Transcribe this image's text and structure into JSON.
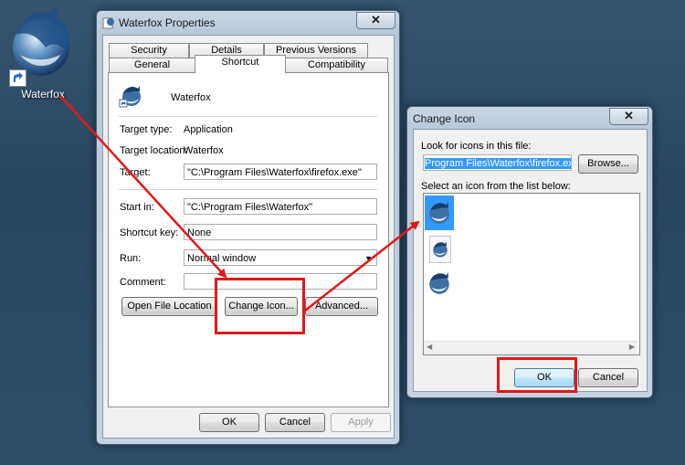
{
  "desktop": {
    "icon_label": "Waterfox"
  },
  "properties": {
    "title": "Waterfox Properties",
    "tabs_row1": [
      "Security",
      "Details",
      "Previous Versions"
    ],
    "tabs_row2": [
      "General",
      "Shortcut",
      "Compatibility"
    ],
    "selected_tab": "Shortcut",
    "app_name": "Waterfox",
    "target_type_label": "Target type:",
    "target_type_value": "Application",
    "target_location_label": "Target location:",
    "target_location_value": "Waterfox",
    "target_label": "Target:",
    "target_value": "\"C:\\Program Files\\Waterfox\\firefox.exe\"",
    "start_in_label": "Start in:",
    "start_in_value": "\"C:\\Program Files\\Waterfox\"",
    "shortcut_key_label": "Shortcut key:",
    "shortcut_key_value": "None",
    "run_label": "Run:",
    "run_value": "Normal window",
    "comment_label": "Comment:",
    "comment_value": "",
    "open_file_location": "Open File Location",
    "change_icon": "Change Icon...",
    "advanced": "Advanced...",
    "ok": "OK",
    "cancel": "Cancel",
    "apply": "Apply"
  },
  "change_icon_dialog": {
    "title": "Change Icon",
    "look_label": "Look for icons in this file:",
    "file_value": "%ProgramFiles%\\Waterfox\\firefox.exe",
    "file_visible": "Program Files\\Waterfox\\firefox.exe",
    "browse": "Browse...",
    "select_label": "Select an icon from the list below:",
    "ok": "OK",
    "cancel": "Cancel"
  },
  "icons": {
    "waterfox": "waterfox-globe-icon",
    "shortcut_overlay": "shortcut-arrow-icon",
    "close": "close-icon",
    "dropdown": "chevron-down-icon"
  },
  "colors": {
    "annotation": "#e0191a",
    "selection": "#3399ff"
  }
}
